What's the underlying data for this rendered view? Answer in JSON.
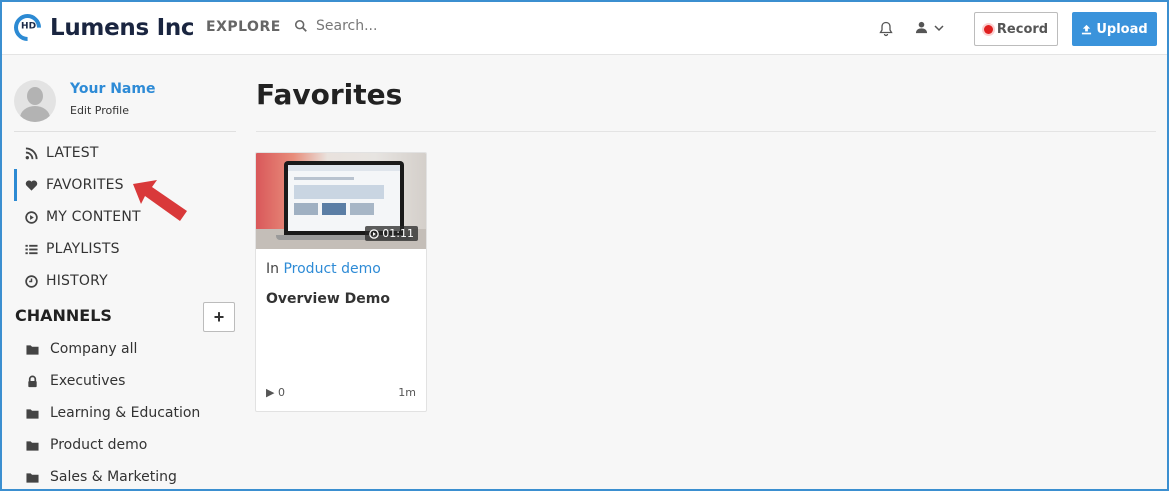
{
  "header": {
    "logo_badge": "HD",
    "app_name": "Lumens Inc",
    "explore_label": "EXPLORE",
    "search_placeholder": "Search...",
    "record_label": "Record",
    "upload_label": "Upload",
    "accent_color": "#3a93db"
  },
  "sidebar": {
    "profile": {
      "name": "Your Name",
      "edit_label": "Edit Profile"
    },
    "nav": [
      {
        "label": "LATEST",
        "icon": "rss-icon",
        "active": false
      },
      {
        "label": "FAVORITES",
        "icon": "heart-icon",
        "active": true
      },
      {
        "label": "MY CONTENT",
        "icon": "play-circle-icon",
        "active": false
      },
      {
        "label": "PLAYLISTS",
        "icon": "list-icon",
        "active": false
      },
      {
        "label": "HISTORY",
        "icon": "clock-icon",
        "active": false
      }
    ],
    "channels_heading": "CHANNELS",
    "add_channel_label": "+",
    "channels": [
      {
        "label": "Company all",
        "icon": "folder-icon"
      },
      {
        "label": "Executives",
        "icon": "lock-icon"
      },
      {
        "label": "Learning & Education",
        "icon": "folder-icon"
      },
      {
        "label": "Product demo",
        "icon": "folder-icon"
      },
      {
        "label": "Sales & Marketing",
        "icon": "folder-icon"
      }
    ]
  },
  "main": {
    "title": "Favorites",
    "cards": [
      {
        "channel_prefix": "In",
        "channel": "Product demo",
        "title": "Overview Demo",
        "duration": "01:11",
        "views": "0",
        "age": "1m"
      }
    ]
  }
}
